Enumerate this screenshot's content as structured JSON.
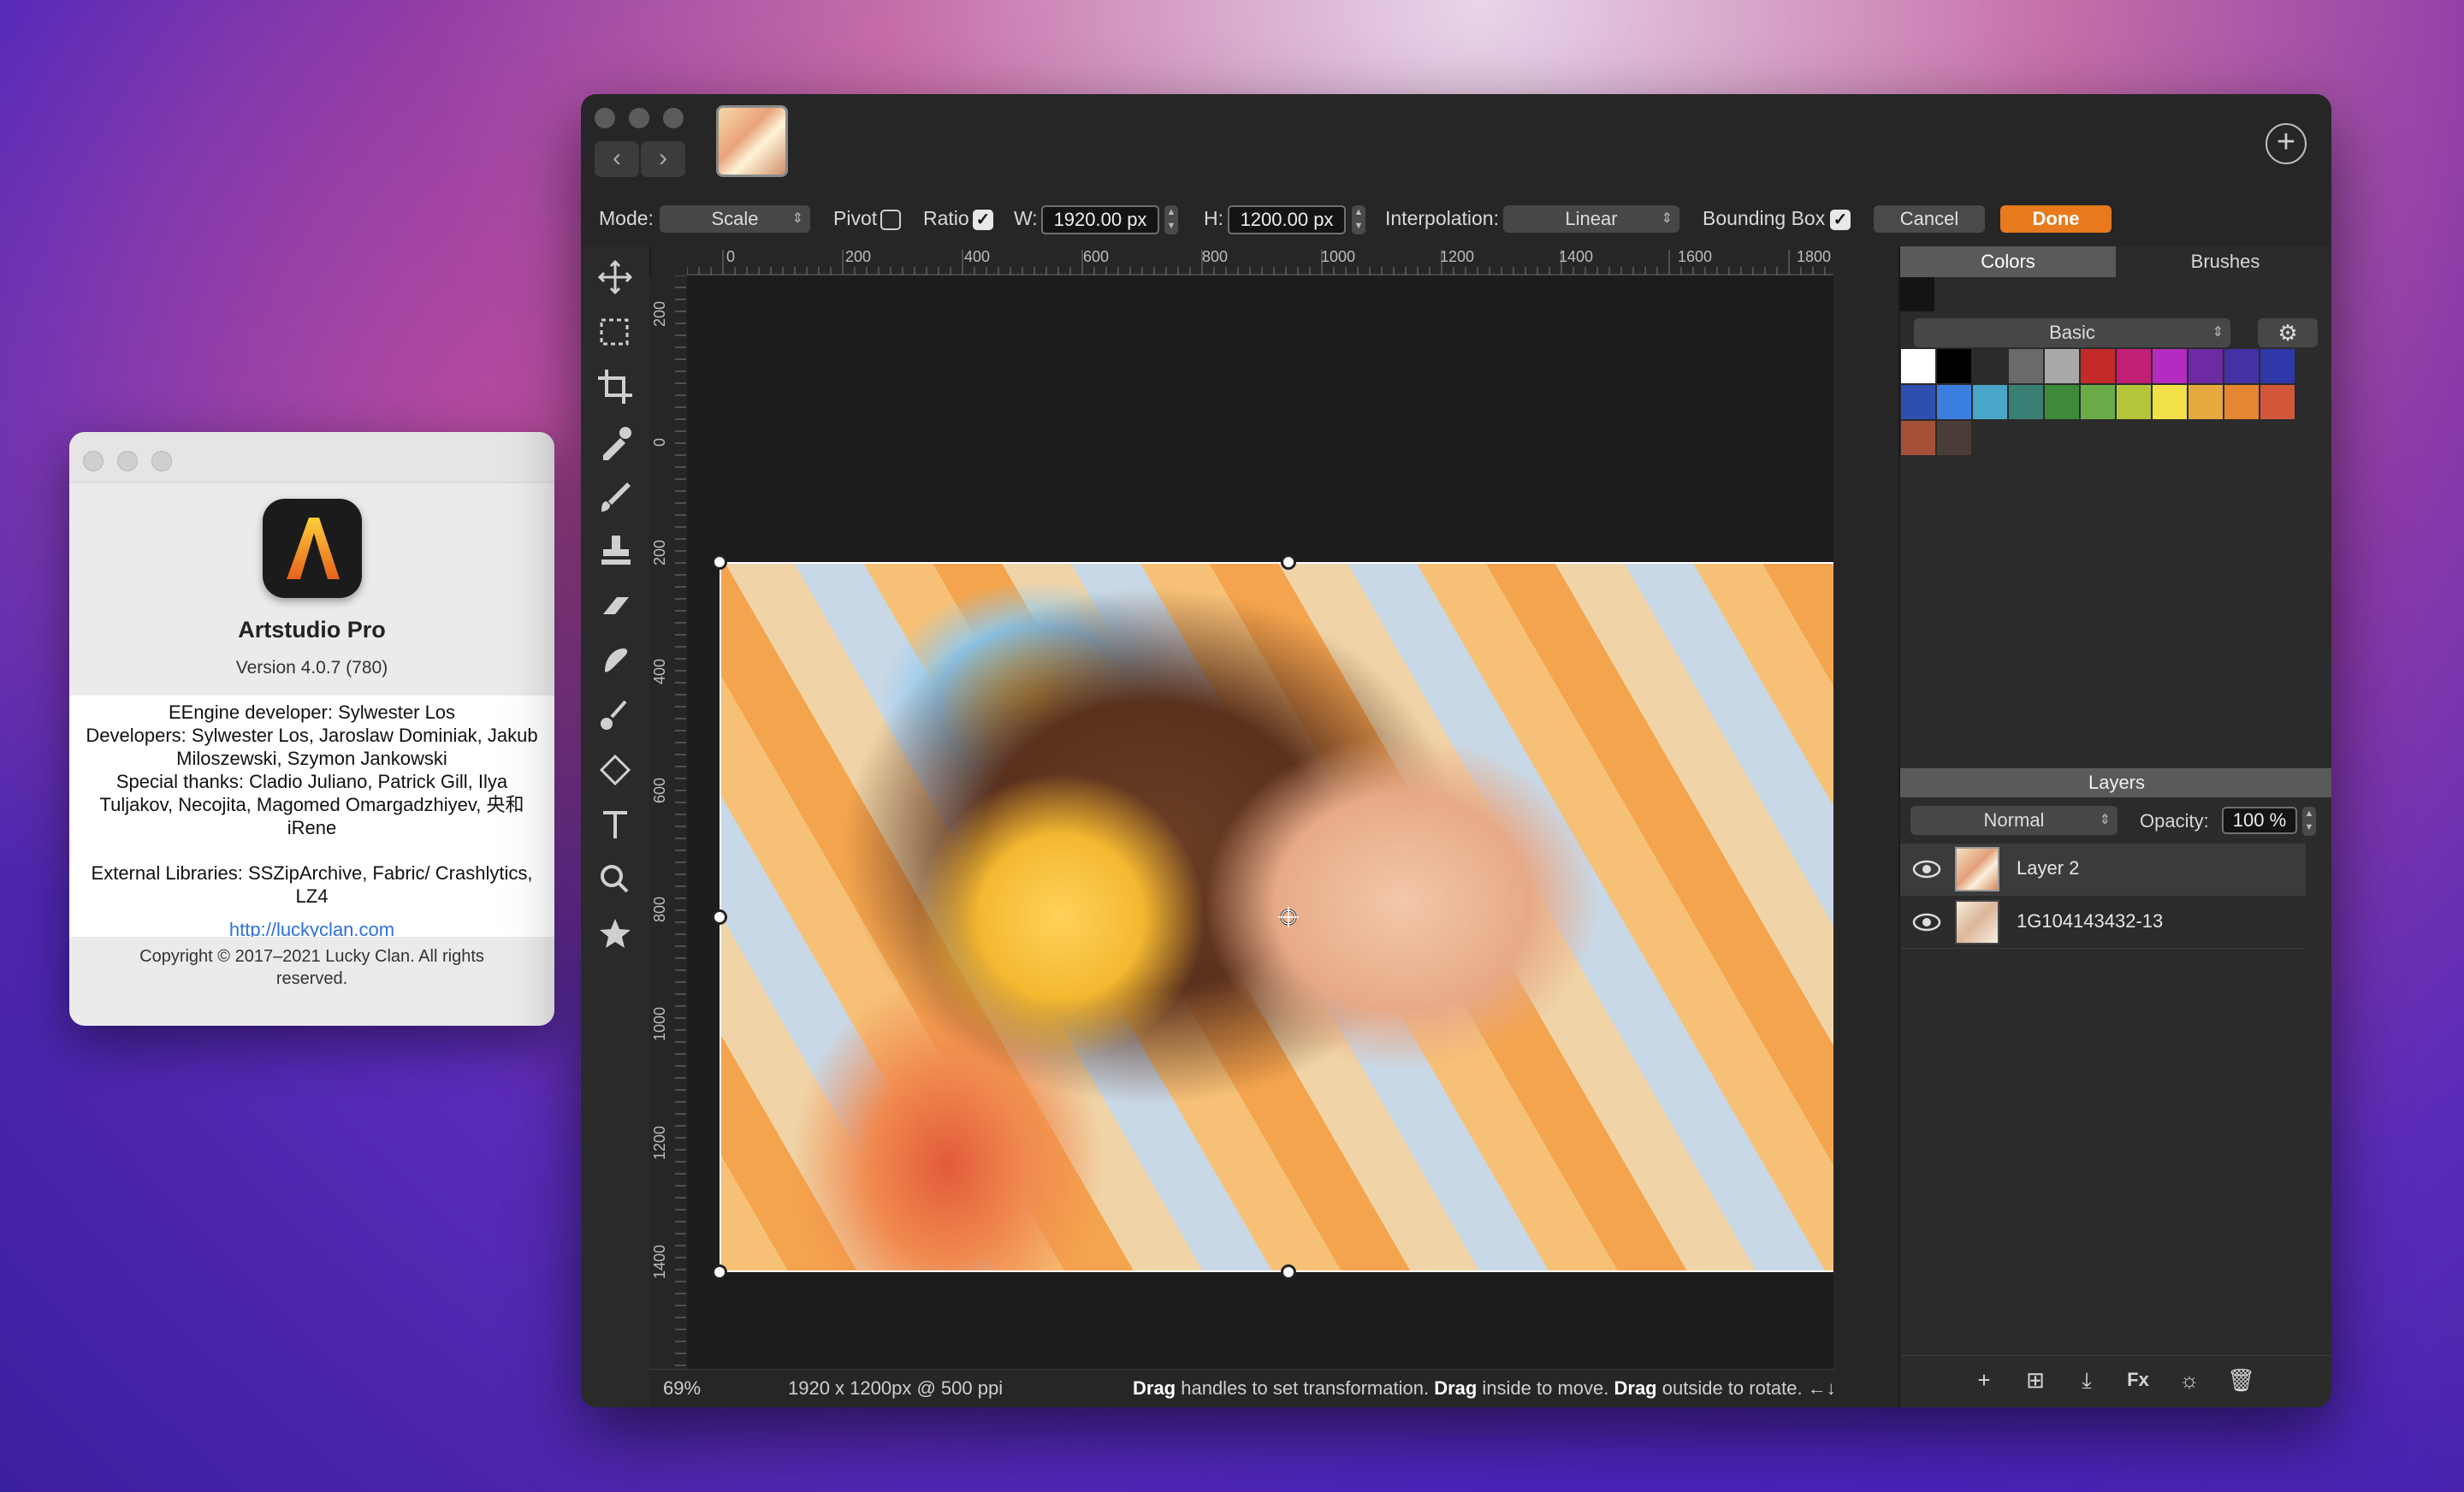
{
  "about": {
    "app_name": "Artstudio Pro",
    "version": "Version 4.0.7 (780)",
    "credits_1": "EEngine developer: Sylwester Los",
    "credits_2": "Developers: Sylwester Los, Jaroslaw Dominiak, Jakub Miloszewski, Szymon Jankowski",
    "credits_3": "Special thanks: Cladio Juliano, Patrick Gill, Ilya Tuljakov, Necojita, Magomed Omargadzhiyev, 央和 iRene",
    "credits_4": "External Libraries: SSZipArchive, Fabric/ Crashlytics, LZ4",
    "link_text": "http://luckyclan.com",
    "copyright": "Copyright © 2017–2021 Lucky Clan. All rights reserved."
  },
  "options": {
    "mode_label": "Mode:",
    "mode_value": "Scale",
    "pivot_label": "Pivot",
    "pivot_checked": false,
    "ratio_label": "Ratio",
    "ratio_checked": true,
    "w_label": "W:",
    "w_value": "1920.00 px",
    "h_label": "H:",
    "h_value": "1200.00 px",
    "interp_label": "Interpolation:",
    "interp_value": "Linear",
    "bbox_label": "Bounding Box",
    "bbox_checked": true,
    "cancel": "Cancel",
    "done": "Done"
  },
  "ruler": {
    "top_ticks": [
      "0",
      "200",
      "400",
      "600",
      "800",
      "1000",
      "1200",
      "1400",
      "1600",
      "1800"
    ],
    "left_ticks": [
      "200",
      "0",
      "200",
      "400",
      "600",
      "800",
      "1000",
      "1200",
      "1400"
    ]
  },
  "status": {
    "zoom": "69%",
    "doc_info": "1920 x 1200px @ 500 ppi",
    "hint_b1": "Drag",
    "hint_t1": " handles to set transformation. ",
    "hint_b2": "Drag",
    "hint_t2": " inside to move. ",
    "hint_b3": "Drag",
    "hint_t3": " outside to rotate. ←↓→↑ to mo"
  },
  "right_panel": {
    "tab_colors": "Colors",
    "tab_brushes": "Brushes",
    "palette_name": "Basic",
    "swatches": [
      "#ffffff",
      "#000000",
      "#2a2a2a",
      "#6a6a6a",
      "#a9a9a9",
      "#c42a2a",
      "#c21f75",
      "#b52bbf",
      "#6d2aa3",
      "#4630a6",
      "#2f38a8",
      "#2e4eb0",
      "#3a7fe0",
      "#4aa6c9",
      "#3a7f74",
      "#3d8a3a",
      "#6aad48",
      "#b5c53a",
      "#f0e04a",
      "#e6a93e",
      "#e68632",
      "#d2573a",
      "#a6503a",
      "#4a3c36"
    ],
    "layers_title": "Layers",
    "blend_mode": "Normal",
    "opacity_label": "Opacity:",
    "opacity_value": "100 %",
    "layers": [
      {
        "name": "Layer 2",
        "selected": true
      },
      {
        "name": "1G104143432-13",
        "selected": false
      }
    ]
  }
}
